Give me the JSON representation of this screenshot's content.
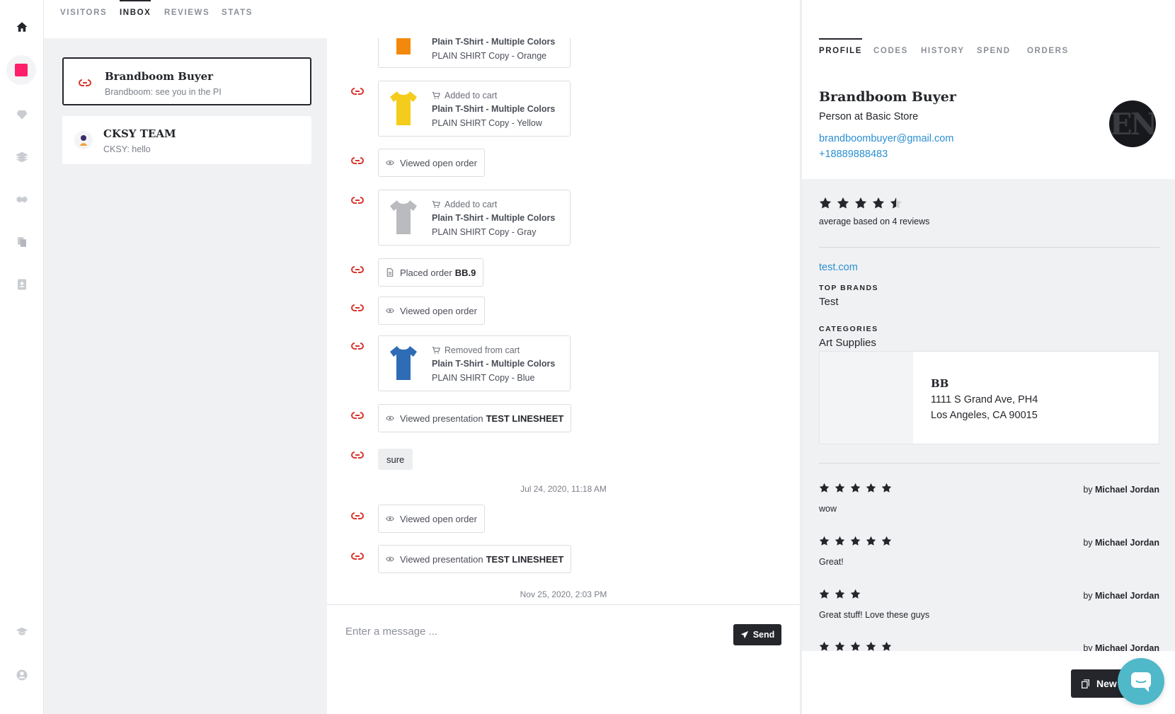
{
  "colors": {
    "accent": "#24262b",
    "link": "#2b8fd1",
    "brand_pink": "#ff1f6a",
    "event_icon": "#d9342b",
    "messenger": "#4fb8c9"
  },
  "rail": {
    "items": [
      {
        "icon": "home-icon",
        "active": true
      },
      {
        "icon": "brand-logo-icon"
      },
      {
        "icon": "diamond-icon"
      },
      {
        "icon": "layers-icon"
      },
      {
        "icon": "handshake-icon"
      },
      {
        "icon": "documents-icon"
      },
      {
        "icon": "contacts-icon"
      },
      {
        "icon": "graduation-cap-icon"
      },
      {
        "icon": "user-circle-icon"
      }
    ]
  },
  "top_tabs": [
    {
      "label": "VISITORS"
    },
    {
      "label": "INBOX",
      "active": true
    },
    {
      "label": "REVIEWS"
    },
    {
      "label": "STATS"
    }
  ],
  "conversations": [
    {
      "name": "Brandboom Buyer",
      "preview": "Brandboom: see you in the PI",
      "active": true
    },
    {
      "name": "CKSY TEAM",
      "preview": "CKSY: hello"
    }
  ],
  "timeline": {
    "card_orange": {
      "product": "Plain T-Shirt - Multiple Colors",
      "variant": "PLAIN SHIRT Copy - Orange",
      "color": "#f2890c"
    },
    "card_yellow": {
      "action": "Added to cart",
      "product": "Plain T-Shirt - Multiple Colors",
      "variant": "PLAIN SHIRT Copy - Yellow",
      "color": "#f4cd1c"
    },
    "viewed_1": {
      "text": "Viewed open order"
    },
    "card_gray": {
      "action": "Added to cart",
      "product": "Plain T-Shirt - Multiple Colors",
      "variant": "PLAIN SHIRT Copy - Gray",
      "color": "#b9bbbe"
    },
    "placed": {
      "text": "Placed order",
      "order": "BB.9"
    },
    "viewed_2": {
      "text": "Viewed open order"
    },
    "card_blue": {
      "action": "Removed from cart",
      "product": "Plain T-Shirt - Multiple Colors",
      "variant": "PLAIN SHIRT Copy - Blue",
      "color": "#2e6cb5"
    },
    "presentation_1": {
      "text": "Viewed presentation",
      "name": "TEST LINESHEET"
    },
    "message": {
      "text": "sure"
    },
    "stamp_1": "Jul 24, 2020, 11:18 AM",
    "viewed_3": {
      "text": "Viewed open order"
    },
    "presentation_2": {
      "text": "Viewed presentation",
      "name": "TEST LINESHEET"
    },
    "stamp_2": "Nov 25, 2020, 2:03 PM"
  },
  "composer": {
    "placeholder": "Enter a message ...",
    "send_label": "Send"
  },
  "profile": {
    "tabs": [
      {
        "label": "PROFILE",
        "active": true
      },
      {
        "label": "CODES"
      },
      {
        "label": "HISTORY"
      },
      {
        "label": "SPEND"
      },
      {
        "label": "ORDERS"
      }
    ],
    "name": "Brandboom Buyer",
    "role": "Person at Basic Store",
    "email": "brandboombuyer@gmail.com",
    "phone": "+18889888483",
    "avatar_text": "tENI",
    "rating": 4.5,
    "rating_caption": "average based on 4 reviews",
    "website": "test.com",
    "top_brands_label": "TOP BRANDS",
    "top_brands": "Test",
    "categories_label": "CATEGORIES",
    "categories": "Art Supplies",
    "address": {
      "name": "BB",
      "line1": "1111 S Grand Ave, PH4",
      "line2": "Los Angeles, CA 90015"
    },
    "reviews": [
      {
        "stars": 5,
        "by": "by",
        "author": "Michael Jordan",
        "text": "wow"
      },
      {
        "stars": 5,
        "by": "by",
        "author": "Michael Jordan",
        "text": "Great!"
      },
      {
        "stars": 3,
        "by": "by",
        "author": "Michael Jordan",
        "text": "Great stuff! Love these guys"
      },
      {
        "stars": 5,
        "by": "by",
        "author": "Michael Jordan",
        "text": ""
      }
    ]
  },
  "new_button_label": "New"
}
